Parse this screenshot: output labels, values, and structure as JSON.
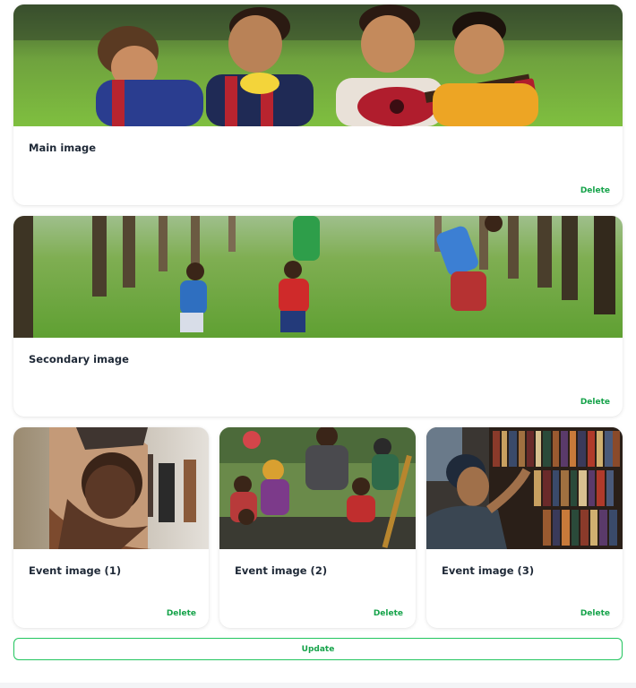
{
  "cards": {
    "main": {
      "title": "Main image",
      "delete_label": "Delete"
    },
    "secondary": {
      "title": "Secondary image",
      "delete_label": "Delete"
    },
    "event1": {
      "title": "Event image (1)",
      "delete_label": "Delete"
    },
    "event2": {
      "title": "Event image (2)",
      "delete_label": "Delete"
    },
    "event3": {
      "title": "Event image (3)",
      "delete_label": "Delete"
    }
  },
  "update_label": "Update",
  "colors": {
    "accent": "#16a34a",
    "accent_border": "#22c55e",
    "title": "#1f2937"
  }
}
